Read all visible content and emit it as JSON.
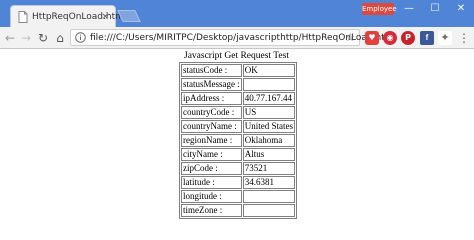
{
  "browser": {
    "tab_title": "HttpReqOnLoad.html",
    "tab_close": "×",
    "profile_badge": "Employee",
    "window_controls": {
      "minimize": "—",
      "maximize": "☐",
      "close": "✕"
    },
    "nav": {
      "back": "←",
      "forward": "→",
      "reload": "↻",
      "home": "⌂"
    },
    "url": "file:///C:/Users/MIRITPC/Desktop/javascripthttp/HttpReqOnLoad.html",
    "star": "☆",
    "extensions": [
      {
        "name": "pocket-icon",
        "glyph": "♥"
      },
      {
        "name": "adblock-icon",
        "glyph": "◉"
      },
      {
        "name": "pinterest-icon",
        "glyph": "P"
      },
      {
        "name": "facebook-icon",
        "glyph": "f"
      },
      {
        "name": "puzzle-icon",
        "glyph": "✦"
      }
    ],
    "menu": "⋮"
  },
  "page": {
    "caption": "Javascript Get Request Test",
    "rows": [
      {
        "key": "statusCode :",
        "value": "OK"
      },
      {
        "key": "statusMessage :",
        "value": ""
      },
      {
        "key": "ipAddress :",
        "value": "40.77.167.44"
      },
      {
        "key": "countryCode :",
        "value": "US"
      },
      {
        "key": "countryName :",
        "value": "United States"
      },
      {
        "key": "regionName :",
        "value": "Oklahoma"
      },
      {
        "key": "cityName :",
        "value": "Altus"
      },
      {
        "key": "zipCode :",
        "value": "73521"
      },
      {
        "key": "latitude :",
        "value": "34.6381"
      },
      {
        "key": "longitude :",
        "value": ""
      },
      {
        "key": "timeZone :",
        "value": ""
      }
    ]
  }
}
